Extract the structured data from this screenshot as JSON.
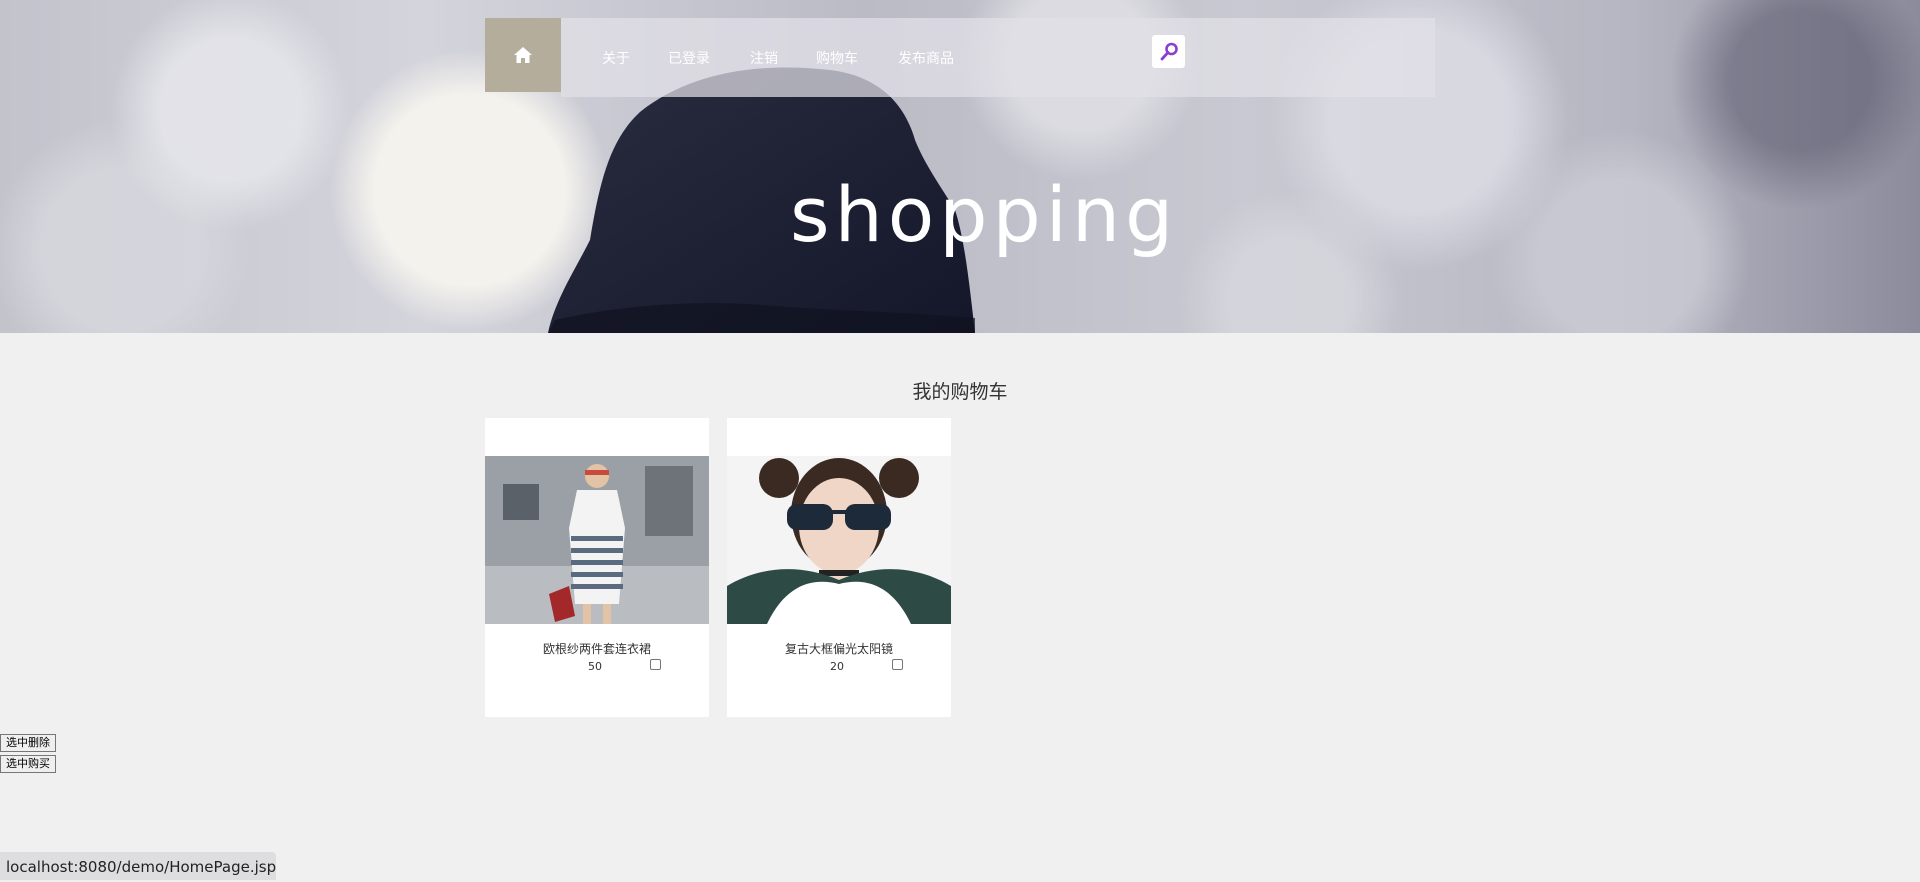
{
  "nav": {
    "home_icon": "home-icon",
    "links": [
      "关于",
      "已登录",
      "注销",
      "购物车",
      "发布商品"
    ],
    "search_icon": "search-icon",
    "colors": {
      "home_bg": "#b4ad9b",
      "search_icon": "#8a3fd0"
    }
  },
  "hero": {
    "title": "shopping"
  },
  "cart": {
    "title": "我的购物车",
    "items": [
      {
        "name": "欧根纱两件套连衣裙",
        "price": "50",
        "checked": false
      },
      {
        "name": "复古大框偏光太阳镜",
        "price": "20",
        "checked": false
      }
    ]
  },
  "actions": {
    "delete_selected": "选中删除",
    "buy_selected": "选中购买"
  },
  "status": {
    "url": "localhost:8080/demo/HomePage.jsp"
  }
}
